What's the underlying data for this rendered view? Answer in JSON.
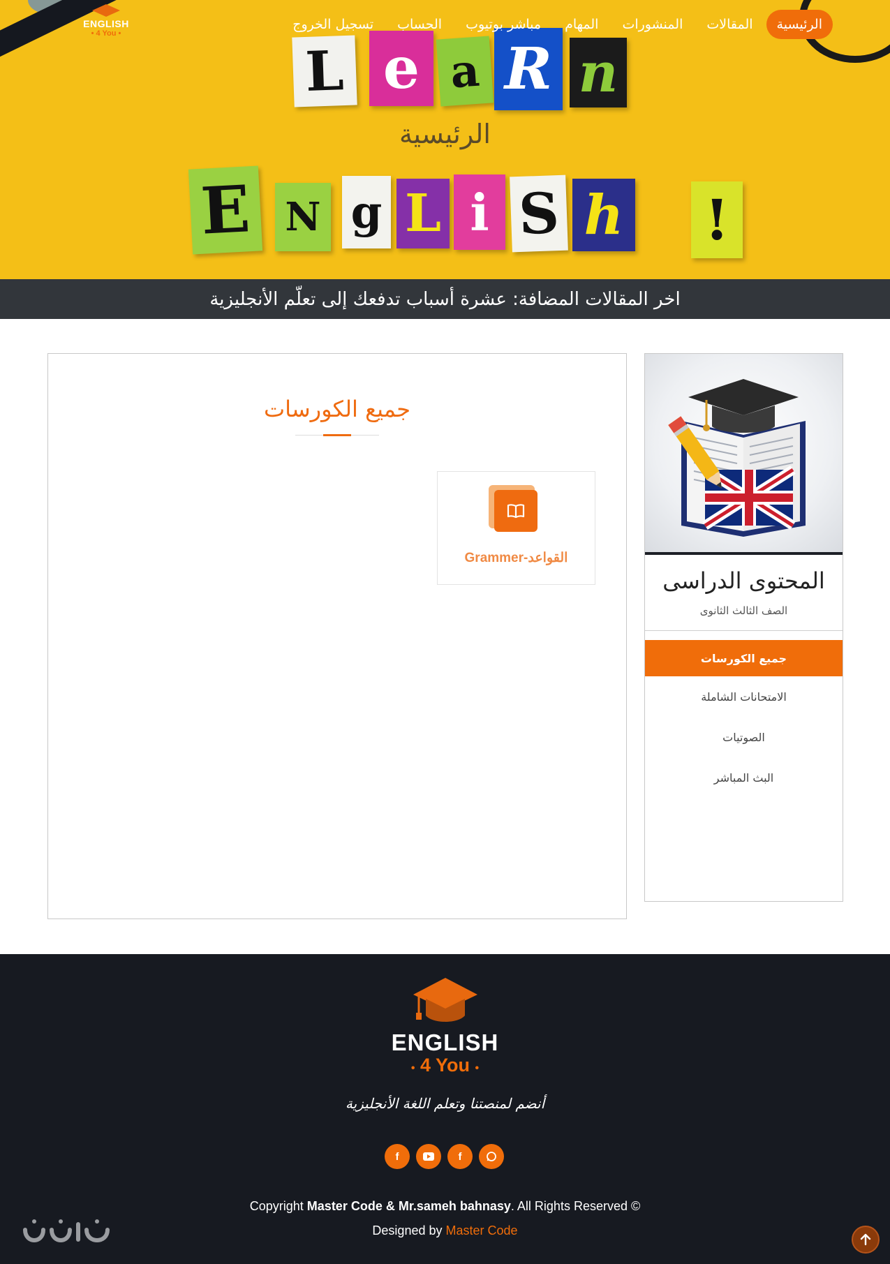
{
  "brand": {
    "name": "ENGLISH",
    "sub": "4 You"
  },
  "nav": {
    "items": [
      {
        "label": "الرئيسية",
        "active": true
      },
      {
        "label": "المقالات"
      },
      {
        "label": "المنشورات"
      },
      {
        "label": "المهام"
      },
      {
        "label": "مباشر بوتيوب"
      },
      {
        "label": "الحساب"
      },
      {
        "label": "تسجيل الخروج"
      }
    ]
  },
  "hero": {
    "title": "الرئيسية",
    "word1": [
      "L",
      "e",
      "a",
      "R",
      "n"
    ],
    "word2": [
      "E",
      "N",
      "g",
      "L",
      "i",
      "S",
      "h",
      "!"
    ]
  },
  "latest": {
    "text": "اخر المقالات المضافة: عشرة أسباب تدفعك إلى تعلّم الأنجليزية"
  },
  "main": {
    "title": "جميع الكورسات",
    "courses": [
      {
        "label": "Grammer-القواعد",
        "icon": "book-icon"
      }
    ]
  },
  "sidebar": {
    "title": "المحتوى الدراسى",
    "subtitle": "الصف الثالث الثانوى",
    "menu": [
      {
        "label": "جميع الكورسات",
        "active": true
      },
      {
        "label": "الامتحانات الشاملة"
      },
      {
        "label": "الصوتيات"
      },
      {
        "label": "البث المباشر"
      }
    ]
  },
  "footer": {
    "tagline": "أنضم لمنصتنا وتعلم اللغة الأنجليزية",
    "socials": [
      "facebook-icon",
      "youtube-icon",
      "facebook-icon",
      "whatsapp-icon"
    ],
    "copyright_prefix": "Copyright",
    "copyright_owner": "Master Code & Mr.sameh bahnasy",
    "copyright_suffix": ". All Rights Reserved ©",
    "designed_prefix": "Designed by",
    "designed_by": "Master Code"
  },
  "colors": {
    "accent": "#f06d0a",
    "hero_bg": "#f4bf17",
    "strip_bg": "#32363b",
    "footer_bg": "#171a21"
  }
}
